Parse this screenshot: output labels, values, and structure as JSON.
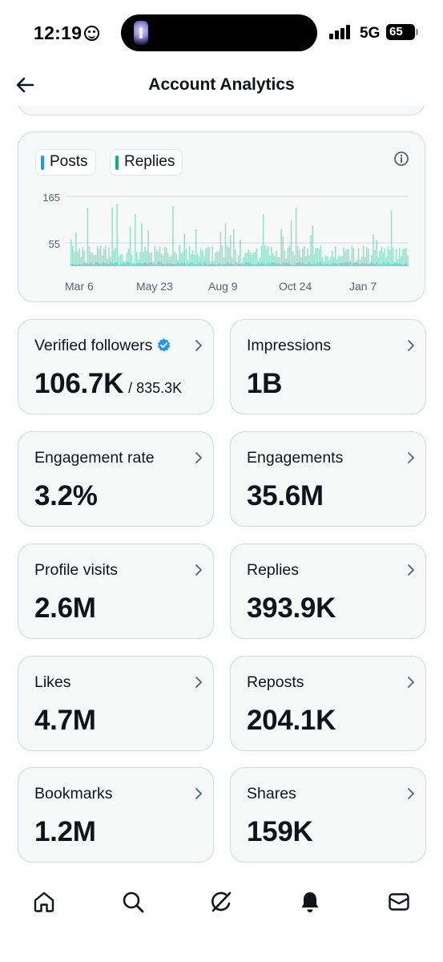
{
  "status_bar": {
    "time": "12:19",
    "network": "5G",
    "battery": "65",
    "signal_bars": [
      0.4,
      0.6,
      0.8,
      1.0
    ]
  },
  "header": {
    "title": "Account Analytics",
    "back_icon": "back-arrow-icon"
  },
  "chart": {
    "legend": [
      {
        "label": "Posts",
        "color": "#1d9bf0"
      },
      {
        "label": "Replies",
        "color": "#00ba7c"
      }
    ],
    "info_icon": "info-icon",
    "chart_data": {
      "type": "bar",
      "y_ticks": [
        "165",
        "55"
      ],
      "x_ticks": [
        "Mar 6",
        "May 23",
        "Aug 9",
        "Oct 24",
        "Jan 7"
      ],
      "ylim": [
        0,
        165
      ],
      "series": [
        {
          "name": "Posts",
          "color": "#1d9bf0"
        },
        {
          "name": "Replies",
          "color": "#00ba7c"
        }
      ]
    }
  },
  "stats": [
    {
      "id": "verified-followers",
      "label": "Verified followers",
      "value": "106.7K",
      "sub": "/ 835.3K",
      "verified": true
    },
    {
      "id": "impressions",
      "label": "Impressions",
      "value": "1B"
    },
    {
      "id": "engagement-rate",
      "label": "Engagement rate",
      "value": "3.2%"
    },
    {
      "id": "engagements",
      "label": "Engagements",
      "value": "35.6M"
    },
    {
      "id": "profile-visits",
      "label": "Profile visits",
      "value": "2.6M"
    },
    {
      "id": "replies",
      "label": "Replies",
      "value": "393.9K"
    },
    {
      "id": "likes",
      "label": "Likes",
      "value": "4.7M"
    },
    {
      "id": "reposts",
      "label": "Reposts",
      "value": "204.1K"
    },
    {
      "id": "bookmarks",
      "label": "Bookmarks",
      "value": "1.2M"
    },
    {
      "id": "shares",
      "label": "Shares",
      "value": "159K"
    }
  ],
  "bottom_nav": [
    "home-icon",
    "search-icon",
    "grok-icon",
    "notifications-icon",
    "messages-icon"
  ],
  "colors": {
    "accent": "#1d9bf0",
    "verified": "#1d9bf0",
    "replies": "#00ba7c"
  }
}
